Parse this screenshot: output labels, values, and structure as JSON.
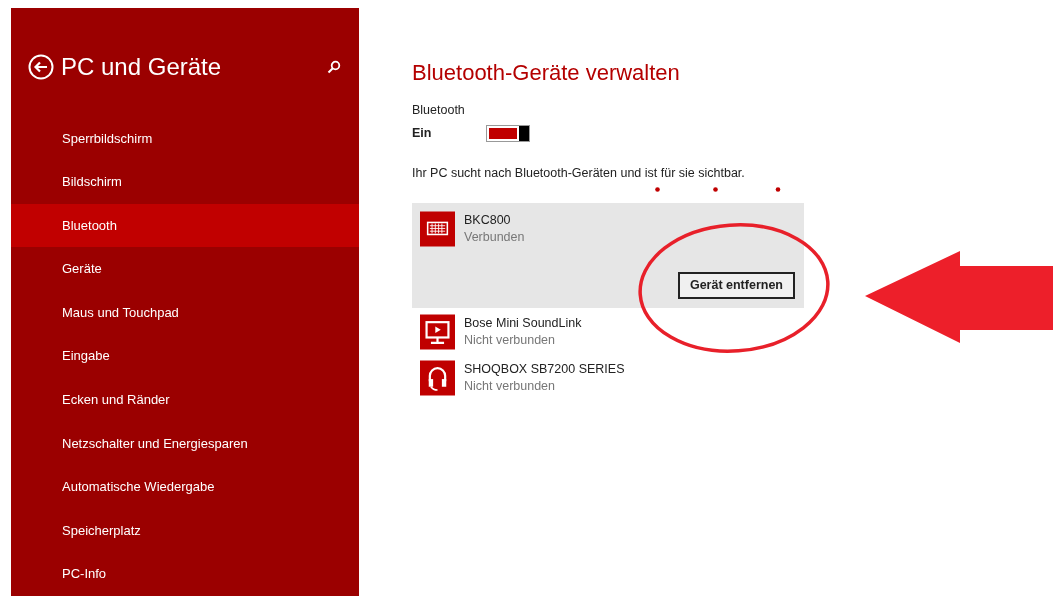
{
  "sidebar": {
    "title": "PC und Geräte",
    "items": [
      {
        "label": "Sperrbildschirm",
        "selected": false
      },
      {
        "label": "Bildschirm",
        "selected": false
      },
      {
        "label": "Bluetooth",
        "selected": true
      },
      {
        "label": "Geräte",
        "selected": false
      },
      {
        "label": "Maus und Touchpad",
        "selected": false
      },
      {
        "label": "Eingabe",
        "selected": false
      },
      {
        "label": "Ecken und Ränder",
        "selected": false
      },
      {
        "label": "Netzschalter und Energiesparen",
        "selected": false
      },
      {
        "label": "Automatische Wiedergabe",
        "selected": false
      },
      {
        "label": "Speicherplatz",
        "selected": false
      },
      {
        "label": "PC-Info",
        "selected": false
      }
    ]
  },
  "main": {
    "title": "Bluetooth-Geräte verwalten",
    "bluetooth": {
      "label": "Bluetooth",
      "state": "Ein",
      "on": true
    },
    "status": "Ihr PC sucht nach Bluetooth-Geräten und ist für sie sichtbar.",
    "devices": [
      {
        "kind": "keyboard",
        "name": "BKC800",
        "status": "Verbunden",
        "selected": true,
        "action": "Gerät entfernen"
      },
      {
        "kind": "display",
        "name": "Bose Mini SoundLink",
        "status": "Nicht verbunden",
        "selected": false
      },
      {
        "kind": "headset",
        "name": "SHOQBOX SB7200 SERIES",
        "status": "Nicht verbunden",
        "selected": false
      }
    ]
  }
}
